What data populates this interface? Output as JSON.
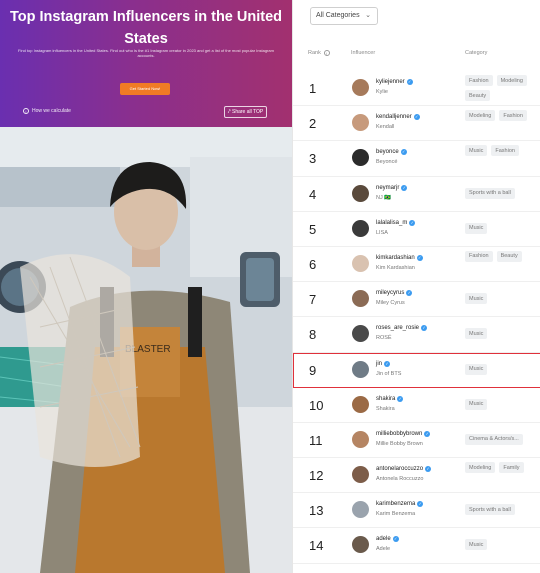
{
  "hero": {
    "title": "Top Instagram Influencers in the United States",
    "subtitle": "Find top Instagram influencers in the United States. Find out who is the #1 Instagram creator in 2023 and get a list of the most popular Instagram accounts.",
    "cta_label": "Get Started Now!",
    "how_label": "How we calculate",
    "share_label": "Share all TOP"
  },
  "filter": {
    "label": "All Categories"
  },
  "table": {
    "col_rank": "Rank",
    "col_influencer": "Influencer",
    "col_category": "Category"
  },
  "rows": [
    {
      "rank": "1",
      "handle": "kyliejenner",
      "name": "Kylie",
      "categories": [
        "Fashion",
        "Modeling",
        "Beauty"
      ],
      "avatar_color": "#a67a5b"
    },
    {
      "rank": "2",
      "handle": "kendalljenner",
      "name": "Kendall",
      "categories": [
        "Modeling",
        "Fashion"
      ],
      "avatar_color": "#c79a7c"
    },
    {
      "rank": "3",
      "handle": "beyonce",
      "name": "Beyoncé",
      "categories": [
        "Music",
        "Fashion"
      ],
      "avatar_color": "#2b2b2b"
    },
    {
      "rank": "4",
      "handle": "neymarjr",
      "name": "NJ 🇧🇷",
      "categories": [
        "Sports with a ball"
      ],
      "avatar_color": "#5a4a3c"
    },
    {
      "rank": "5",
      "handle": "lalalalisa_m",
      "name": "LISA",
      "categories": [
        "Music"
      ],
      "avatar_color": "#3a3a3a"
    },
    {
      "rank": "6",
      "handle": "kimkardashian",
      "name": "Kim Kardashian",
      "categories": [
        "Fashion",
        "Beauty"
      ],
      "avatar_color": "#d9c2b0"
    },
    {
      "rank": "7",
      "handle": "mileycyrus",
      "name": "Miley Cyrus",
      "categories": [
        "Music"
      ],
      "avatar_color": "#8b6b55"
    },
    {
      "rank": "8",
      "handle": "roses_are_rosie",
      "name": "ROSÉ",
      "categories": [
        "Music"
      ],
      "avatar_color": "#4a4a4a"
    },
    {
      "rank": "9",
      "handle": "jin",
      "name": "Jin of BTS",
      "categories": [
        "Music"
      ],
      "avatar_color": "#6f7b86"
    },
    {
      "rank": "10",
      "handle": "shakira",
      "name": "Shakira",
      "categories": [
        "Music"
      ],
      "avatar_color": "#9b6a45"
    },
    {
      "rank": "11",
      "handle": "milliebobbybrown",
      "name": "Millie Bobby Brown",
      "categories": [
        "Cinema & Actors/s..."
      ],
      "avatar_color": "#b58563"
    },
    {
      "rank": "12",
      "handle": "antonelaroccuzzo",
      "name": "Antonela Roccuzzo",
      "categories": [
        "Modeling",
        "Family"
      ],
      "avatar_color": "#7d5d49"
    },
    {
      "rank": "13",
      "handle": "karimbenzema",
      "name": "Karim Benzema",
      "categories": [
        "Sports with a ball"
      ],
      "avatar_color": "#9aa3ad"
    },
    {
      "rank": "14",
      "handle": "adele",
      "name": "Adele",
      "categories": [
        "Music"
      ],
      "avatar_color": "#6a5a4c"
    }
  ],
  "highlight_rank": "9",
  "colors": {
    "hero_start": "#6a2fb0",
    "hero_end": "#a2306f",
    "cta": "#f07b25",
    "highlight": "#e0313b",
    "verified": "#3b9bf0"
  },
  "photo_text": "BLASTER"
}
